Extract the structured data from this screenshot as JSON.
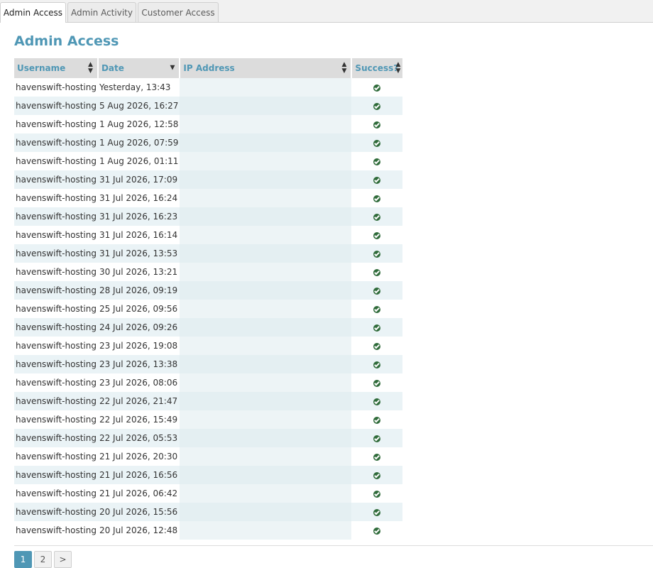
{
  "tabs": [
    {
      "label": "Admin Access",
      "active": true
    },
    {
      "label": "Admin Activity",
      "active": false
    },
    {
      "label": "Customer Access",
      "active": false
    }
  ],
  "page_title": "Admin Access",
  "table": {
    "columns": [
      {
        "label": "Username",
        "sort": "both"
      },
      {
        "label": "Date",
        "sort": "desc"
      },
      {
        "label": "IP Address",
        "sort": "both"
      },
      {
        "label": "Success?",
        "sort": "both"
      }
    ],
    "rows": [
      {
        "username": "havenswift-hosting",
        "date": "Yesterday, 13:43",
        "success": true
      },
      {
        "username": "havenswift-hosting",
        "date": "5 Aug 2026, 16:27",
        "success": true
      },
      {
        "username": "havenswift-hosting",
        "date": "1 Aug 2026, 12:58",
        "success": true
      },
      {
        "username": "havenswift-hosting",
        "date": "1 Aug 2026, 07:59",
        "success": true
      },
      {
        "username": "havenswift-hosting",
        "date": "1 Aug 2026, 01:11",
        "success": true
      },
      {
        "username": "havenswift-hosting",
        "date": "31 Jul 2026, 17:09",
        "success": true
      },
      {
        "username": "havenswift-hosting",
        "date": "31 Jul 2026, 16:24",
        "success": true
      },
      {
        "username": "havenswift-hosting",
        "date": "31 Jul 2026, 16:23",
        "success": true
      },
      {
        "username": "havenswift-hosting",
        "date": "31 Jul 2026, 16:14",
        "success": true
      },
      {
        "username": "havenswift-hosting",
        "date": "31 Jul 2026, 13:53",
        "success": true
      },
      {
        "username": "havenswift-hosting",
        "date": "30 Jul 2026, 13:21",
        "success": true
      },
      {
        "username": "havenswift-hosting",
        "date": "28 Jul 2026, 09:19",
        "success": true
      },
      {
        "username": "havenswift-hosting",
        "date": "25 Jul 2026, 09:56",
        "success": true
      },
      {
        "username": "havenswift-hosting",
        "date": "24 Jul 2026, 09:26",
        "success": true
      },
      {
        "username": "havenswift-hosting",
        "date": "23 Jul 2026, 19:08",
        "success": true
      },
      {
        "username": "havenswift-hosting",
        "date": "23 Jul 2026, 13:38",
        "success": true
      },
      {
        "username": "havenswift-hosting",
        "date": "23 Jul 2026, 08:06",
        "success": true
      },
      {
        "username": "havenswift-hosting",
        "date": "22 Jul 2026, 21:47",
        "success": true
      },
      {
        "username": "havenswift-hosting",
        "date": "22 Jul 2026, 15:49",
        "success": true
      },
      {
        "username": "havenswift-hosting",
        "date": "22 Jul 2026, 05:53",
        "success": true
      },
      {
        "username": "havenswift-hosting",
        "date": "21 Jul 2026, 20:30",
        "success": true
      },
      {
        "username": "havenswift-hosting",
        "date": "21 Jul 2026, 16:56",
        "success": true
      },
      {
        "username": "havenswift-hosting",
        "date": "21 Jul 2026, 06:42",
        "success": true
      },
      {
        "username": "havenswift-hosting",
        "date": "20 Jul 2026, 15:56",
        "success": true
      },
      {
        "username": "havenswift-hosting",
        "date": "20 Jul 2026, 12:48",
        "success": true
      }
    ]
  },
  "pagination": {
    "pages": [
      "1",
      "2"
    ],
    "current": "1",
    "next_label": ">"
  },
  "icons": {
    "success": "check-circle-icon",
    "sort_both": "sort-icon",
    "sort_desc": "sort-desc-icon"
  },
  "colors": {
    "accent": "#4f97b5",
    "success": "#2f6b3a",
    "header_bg": "#dcdcdc",
    "row_stripe": "#eaf3f6"
  }
}
